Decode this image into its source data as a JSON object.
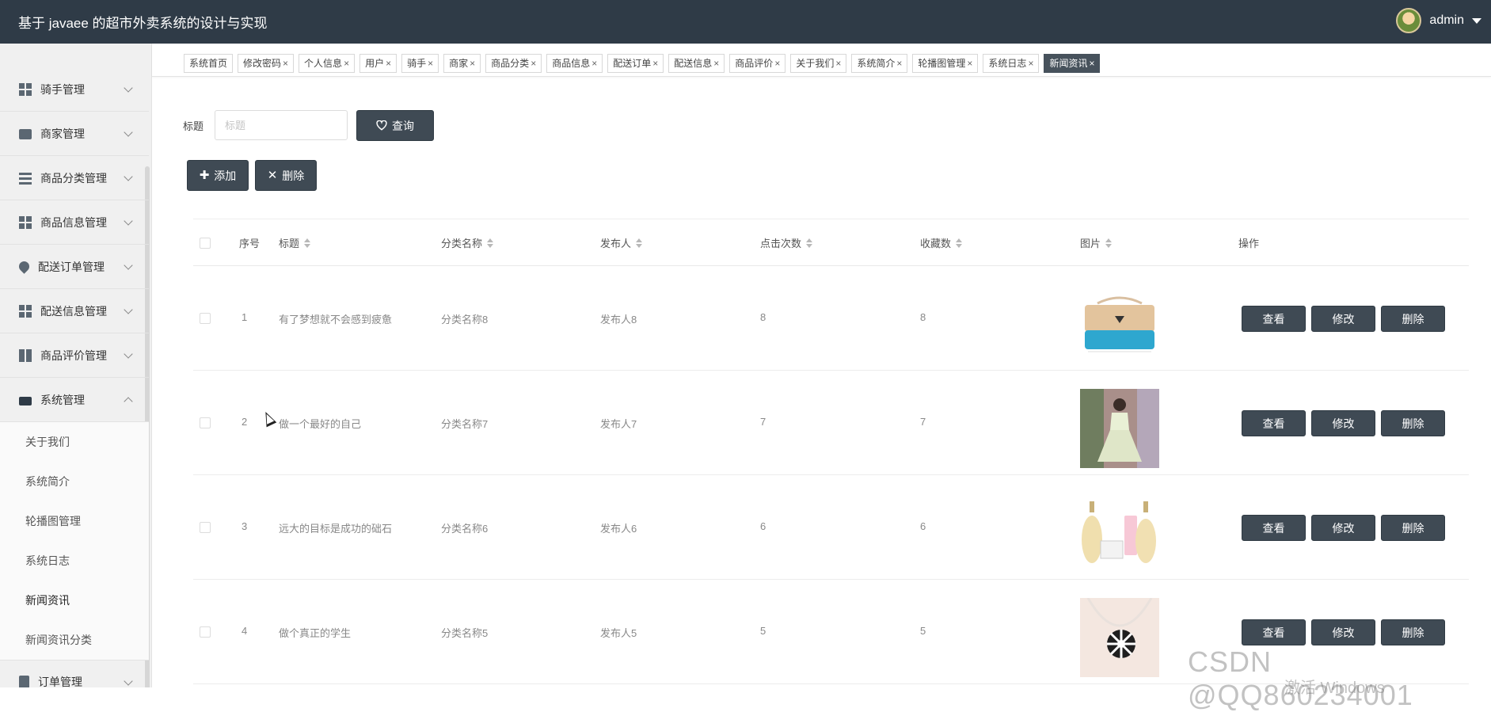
{
  "header": {
    "title": "基于 javaee 的超市外卖系统的设计与实现",
    "username": "admin",
    "bg_color": "#2f3b47"
  },
  "sidebar": {
    "items": [
      {
        "label": "骑手管理",
        "icon": "grid-icon",
        "expanded": false
      },
      {
        "label": "商家管理",
        "icon": "briefcase-icon",
        "expanded": false
      },
      {
        "label": "商品分类管理",
        "icon": "list-icon",
        "expanded": false
      },
      {
        "label": "商品信息管理",
        "icon": "grid-icon",
        "expanded": false
      },
      {
        "label": "配送订单管理",
        "icon": "map-pin-icon",
        "expanded": false
      },
      {
        "label": "配送信息管理",
        "icon": "grid-icon",
        "expanded": false
      },
      {
        "label": "商品评价管理",
        "icon": "book-icon",
        "expanded": false
      },
      {
        "label": "系统管理",
        "icon": "ticket-icon",
        "expanded": true
      }
    ],
    "sub_items": [
      {
        "label": "关于我们",
        "active": false
      },
      {
        "label": "系统简介",
        "active": false
      },
      {
        "label": "轮播图管理",
        "active": false
      },
      {
        "label": "系统日志",
        "active": false
      },
      {
        "label": "新闻资讯",
        "active": true
      },
      {
        "label": "新闻资讯分类",
        "active": false
      }
    ],
    "bottom_item": {
      "label": "订单管理",
      "icon": "clipboard-icon"
    }
  },
  "tabs": [
    {
      "label": "系统首页",
      "closable": false,
      "active": false
    },
    {
      "label": "修改密码",
      "closable": true,
      "active": false
    },
    {
      "label": "个人信息",
      "closable": true,
      "active": false
    },
    {
      "label": "用户",
      "closable": true,
      "active": false
    },
    {
      "label": "骑手",
      "closable": true,
      "active": false
    },
    {
      "label": "商家",
      "closable": true,
      "active": false
    },
    {
      "label": "商品分类",
      "closable": true,
      "active": false
    },
    {
      "label": "商品信息",
      "closable": true,
      "active": false
    },
    {
      "label": "配送订单",
      "closable": true,
      "active": false
    },
    {
      "label": "配送信息",
      "closable": true,
      "active": false
    },
    {
      "label": "商品评价",
      "closable": true,
      "active": false
    },
    {
      "label": "关于我们",
      "closable": true,
      "active": false
    },
    {
      "label": "系统简介",
      "closable": true,
      "active": false
    },
    {
      "label": "轮播图管理",
      "closable": true,
      "active": false
    },
    {
      "label": "系统日志",
      "closable": true,
      "active": false
    },
    {
      "label": "新闻资讯",
      "closable": true,
      "active": true
    }
  ],
  "close_glyph": "×",
  "search": {
    "label": "标题",
    "placeholder": "标题",
    "value": "",
    "query_label": "查询",
    "query_icon": "heart-icon"
  },
  "actions": {
    "add_label": "添加",
    "add_icon": "plus-icon",
    "delete_label": "删除",
    "delete_icon": "x-icon"
  },
  "table": {
    "columns": {
      "index": "序号",
      "title": "标题",
      "category": "分类名称",
      "publisher": "发布人",
      "clicks": "点击次数",
      "favorites": "收藏数",
      "image": "图片",
      "ops": "操作"
    },
    "rows": [
      {
        "index": "1",
        "title": "有了梦想就不会感到疲惫",
        "category": "分类名称8",
        "publisher": "发布人8",
        "clicks": "8",
        "favorites": "8",
        "image": "handbag"
      },
      {
        "index": "2",
        "title": "做一个最好的自己",
        "category": "分类名称7",
        "publisher": "发布人7",
        "clicks": "7",
        "favorites": "7",
        "image": "dress"
      },
      {
        "index": "3",
        "title": "远大的目标是成功的础石",
        "category": "分类名称6",
        "publisher": "发布人6",
        "clicks": "6",
        "favorites": "6",
        "image": "perfume"
      },
      {
        "index": "4",
        "title": "做个真正的学生",
        "category": "分类名称5",
        "publisher": "发布人5",
        "clicks": "5",
        "favorites": "5",
        "image": "necklace"
      }
    ],
    "row_actions": {
      "view": "查看",
      "edit": "修改",
      "delete": "删除"
    }
  },
  "watermark": {
    "csdn": "CSDN @QQ860234001",
    "windows": "激活 Windows"
  }
}
